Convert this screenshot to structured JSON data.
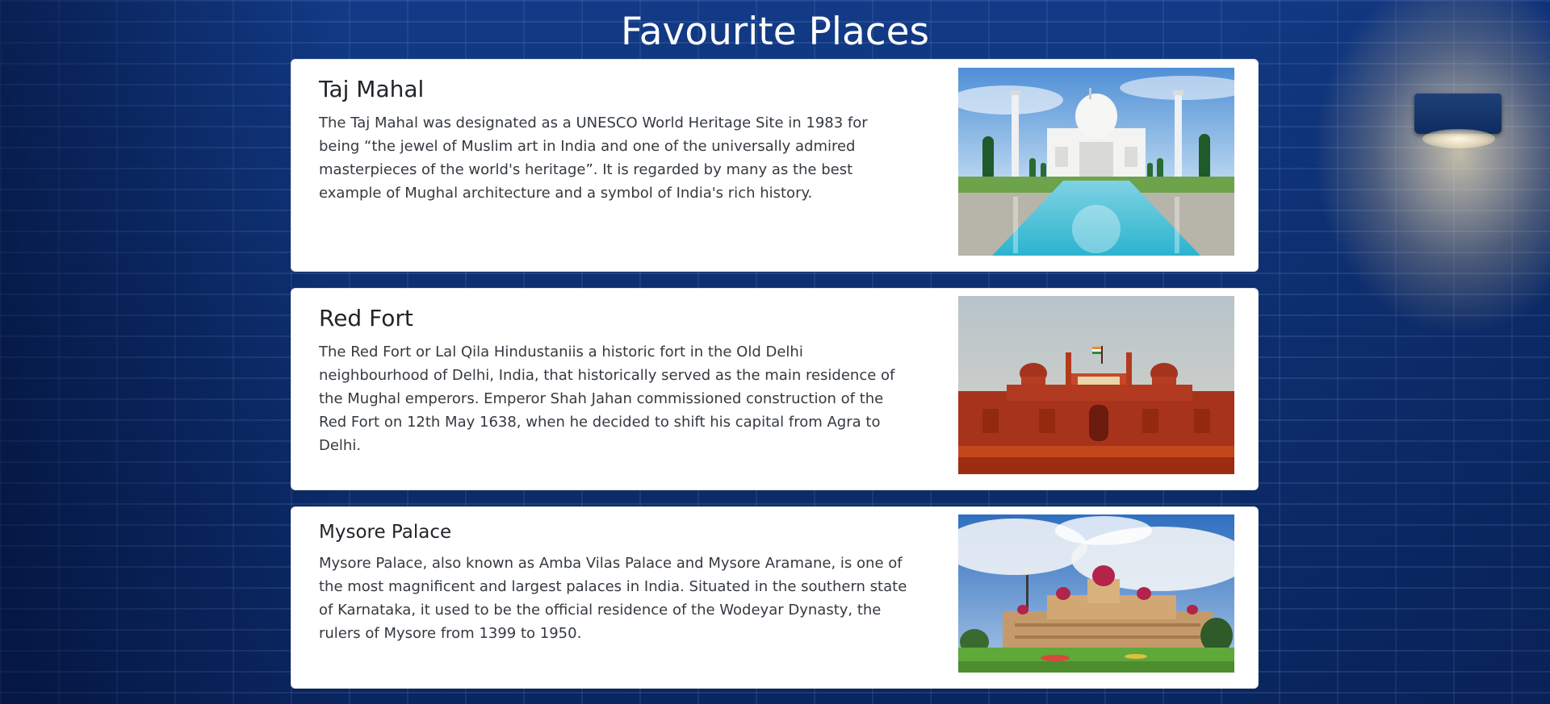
{
  "page": {
    "title": "Favourite Places"
  },
  "places": [
    {
      "title": "Taj Mahal",
      "description": "The Taj Mahal was designated as a UNESCO World Heritage Site in 1983 for being “the jewel of Muslim art in India and one of the universally admired masterpieces of the world's heritage”. It is regarded by many as the best example of Mughal architecture and a symbol of India's rich history.",
      "image": "taj-mahal-photo"
    },
    {
      "title": "Red Fort",
      "description": "The Red Fort or Lal Qila Hindustaniis a historic fort in the Old Delhi neighbourhood of Delhi, India, that historically served as the main residence of the Mughal emperors. Emperor Shah Jahan commissioned construction of the Red Fort on 12th May 1638, when he decided to shift his capital from Agra to Delhi.",
      "image": "red-fort-photo"
    },
    {
      "title": "Mysore Palace",
      "description": "Mysore Palace, also known as Amba Vilas Palace and Mysore Aramane, is one of the most magnificent and largest palaces in India. Situated in the southern state of Karnataka, it used to be the official residence of the Wodeyar Dynasty, the rulers of Mysore from 1399 to 1950.",
      "image": "mysore-palace-photo"
    }
  ],
  "colors": {
    "background": "#0c2a66",
    "card": "#ffffff",
    "title_text": "#ffffff",
    "body_text": "#343a40"
  }
}
